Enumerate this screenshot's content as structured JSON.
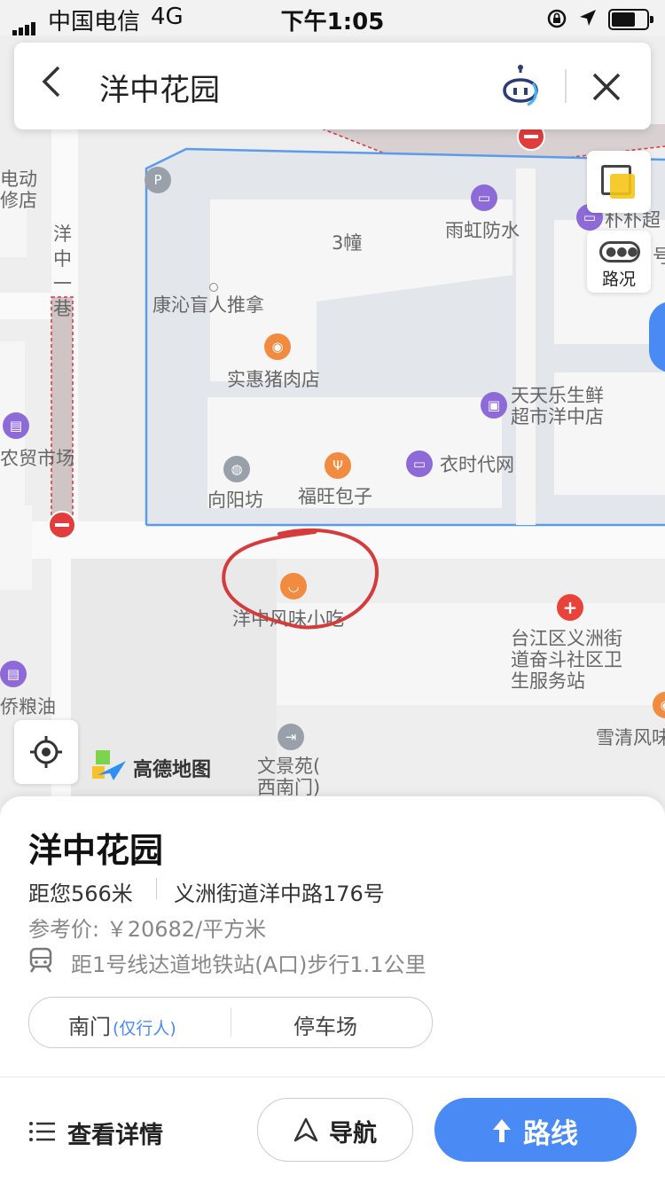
{
  "status_bar": {
    "carrier": "中国电信",
    "network": "4G",
    "time": "下午1:05"
  },
  "search": {
    "back_icon": "chevron-left-icon",
    "query": "洋中花园",
    "assistant_icon": "robot-assistant-icon",
    "close_icon": "close-icon"
  },
  "map": {
    "labels": {
      "ev_repair": "电动\n修店",
      "lane": "洋\n中\n一\n巷",
      "building3": "3幢",
      "massage": "康沁盲人推拿",
      "pork": "实惠猪肉店",
      "yuhong": "雨虹防水",
      "supermarket_right": "朴朴超",
      "hao": "号",
      "tiantian": "天天乐生鲜\n超市洋中店",
      "market": "农贸市场",
      "yiyang": "向阳坊",
      "fuwang": "福旺包子",
      "yishidai": "衣时代网",
      "snack": "洋中风味小吃",
      "clinic": "台江区义洲街\n道奋斗社区卫\n生服务站",
      "grain": "侨粮油",
      "wenjingyuan": "文景苑(\n西南门)",
      "xueqing": "雪清风味"
    },
    "layer_button_icon": "layers-icon",
    "traffic_label": "路况",
    "locate_icon": "locate-icon",
    "brand": "高德地图"
  },
  "panel": {
    "title": "洋中花园",
    "distance": "距您566米",
    "address": "义洲街道洋中路176号",
    "price": "参考价: ￥20682/平方米",
    "subway": "距1号线达道地铁站(A口)步行1.1公里",
    "entrance_south": "南门",
    "entrance_south_note": "(仅行人)",
    "parking": "停车场",
    "details_label": "查看详情",
    "navigate_label": "导航",
    "route_label": "路线"
  }
}
